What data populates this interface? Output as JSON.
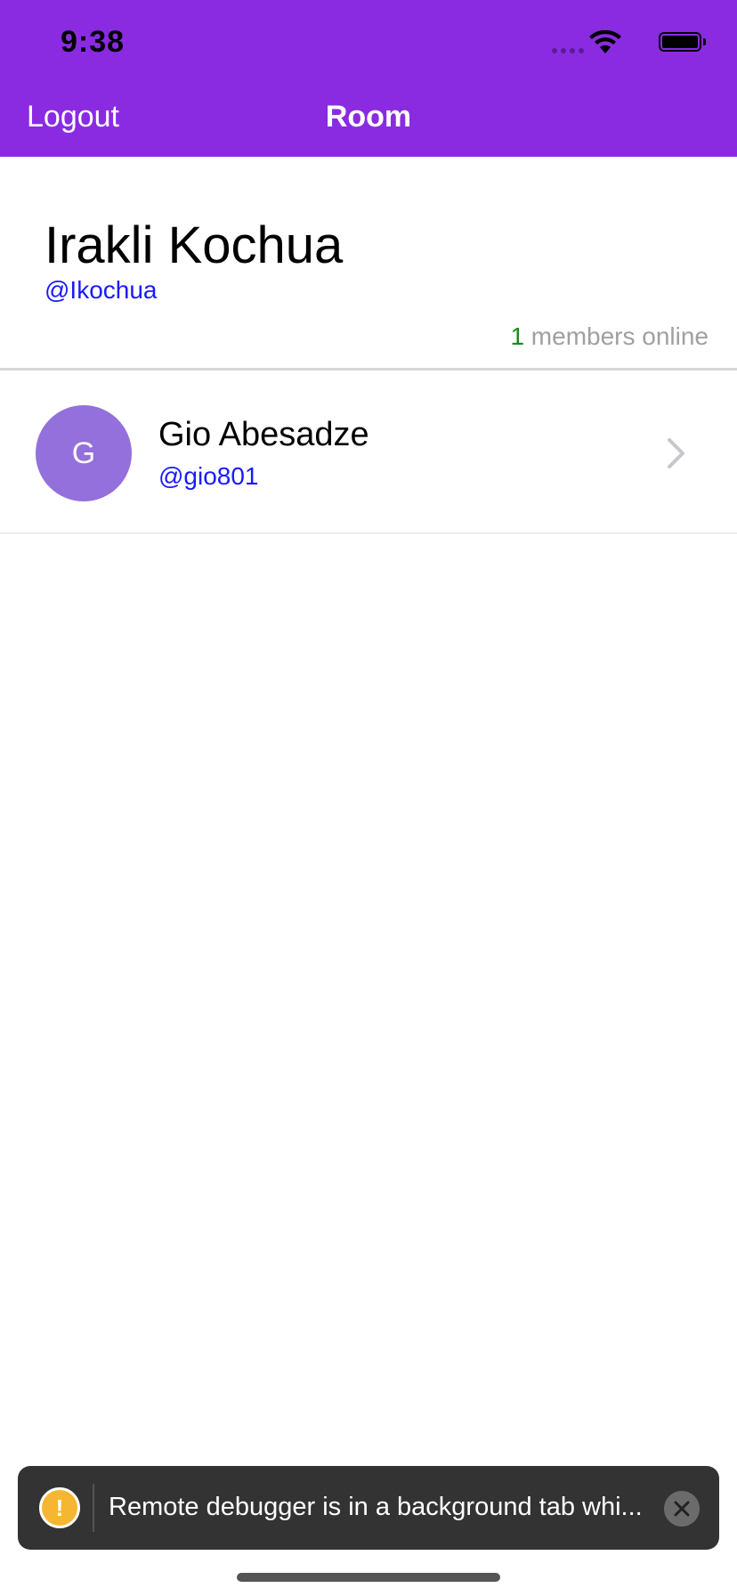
{
  "status_bar": {
    "time": "9:38"
  },
  "nav": {
    "left_label": "Logout",
    "title": "Room"
  },
  "room": {
    "name": "Irakli Kochua",
    "handle": "@Ikochua",
    "online_count": "1",
    "online_label": " members online"
  },
  "members": [
    {
      "initial": "G",
      "name": "Gio Abesadze",
      "handle": "@gio801"
    }
  ],
  "toast": {
    "icon_glyph": "!",
    "message": "Remote debugger is in a background tab whi..."
  },
  "colors": {
    "header": "#8a2be2",
    "avatar": "#9370db",
    "link": "#1a1aff",
    "online": "#1a8a1a"
  }
}
